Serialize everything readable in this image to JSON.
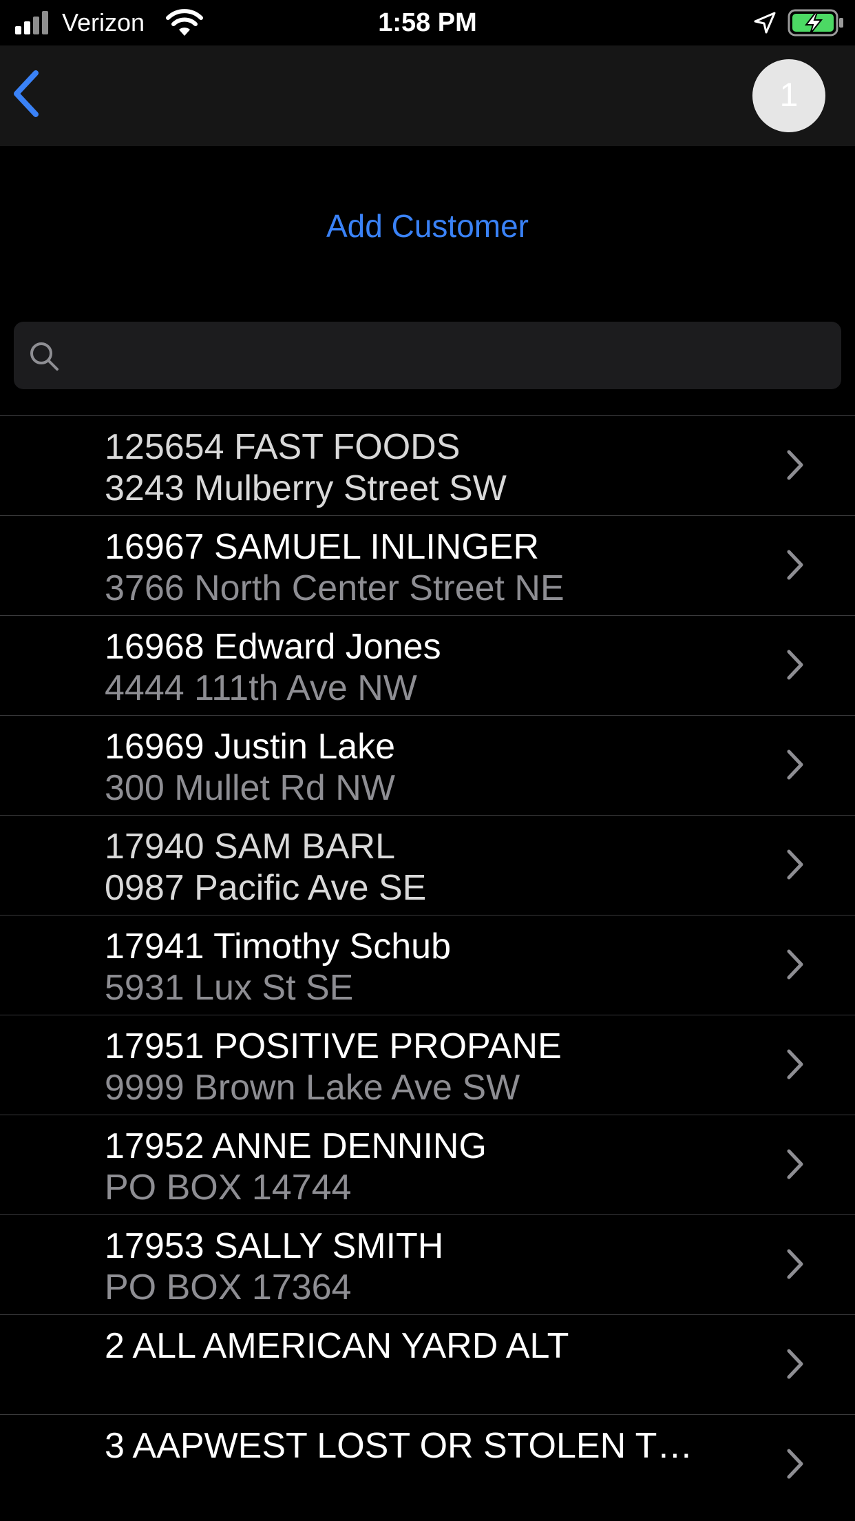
{
  "status_bar": {
    "carrier": "Verizon",
    "time": "1:58 PM",
    "icons": [
      "signal-icon",
      "wifi-icon",
      "location-arrow-icon",
      "battery-charging-icon"
    ]
  },
  "nav": {
    "back_icon": "chevron-left-icon",
    "badge_count": "1"
  },
  "add_customer_label": "Add Customer",
  "search": {
    "placeholder": "",
    "value": ""
  },
  "colors": {
    "accent": "#3a82f7",
    "background": "#000000",
    "nav_background": "#161616",
    "search_background": "#1c1c1e",
    "secondary_text": "#8e8e93"
  },
  "customers": [
    {
      "title": "125654 FAST FOODS",
      "address": "3243 Mulberry Street SW"
    },
    {
      "title": "16967 SAMUEL INLINGER",
      "address": "3766 North Center Street NE"
    },
    {
      "title": "16968 Edward Jones",
      "address": "4444 111th Ave NW"
    },
    {
      "title": "16969 Justin Lake",
      "address": "300 Mullet Rd NW"
    },
    {
      "title": "17940 SAM BARL",
      "address": "0987 Pacific Ave SE"
    },
    {
      "title": "17941 Timothy Schub",
      "address": "5931 Lux St SE"
    },
    {
      "title": "17951 POSITIVE PROPANE",
      "address": "9999 Brown Lake Ave SW"
    },
    {
      "title": "17952 ANNE DENNING",
      "address": "PO BOX 14744"
    },
    {
      "title": "17953 SALLY SMITH",
      "address": "PO BOX 17364"
    },
    {
      "title": "2 ALL AMERICAN YARD ALT",
      "address": ""
    },
    {
      "title": "3 AAPWEST LOST OR STOLEN T…",
      "address": ""
    }
  ]
}
